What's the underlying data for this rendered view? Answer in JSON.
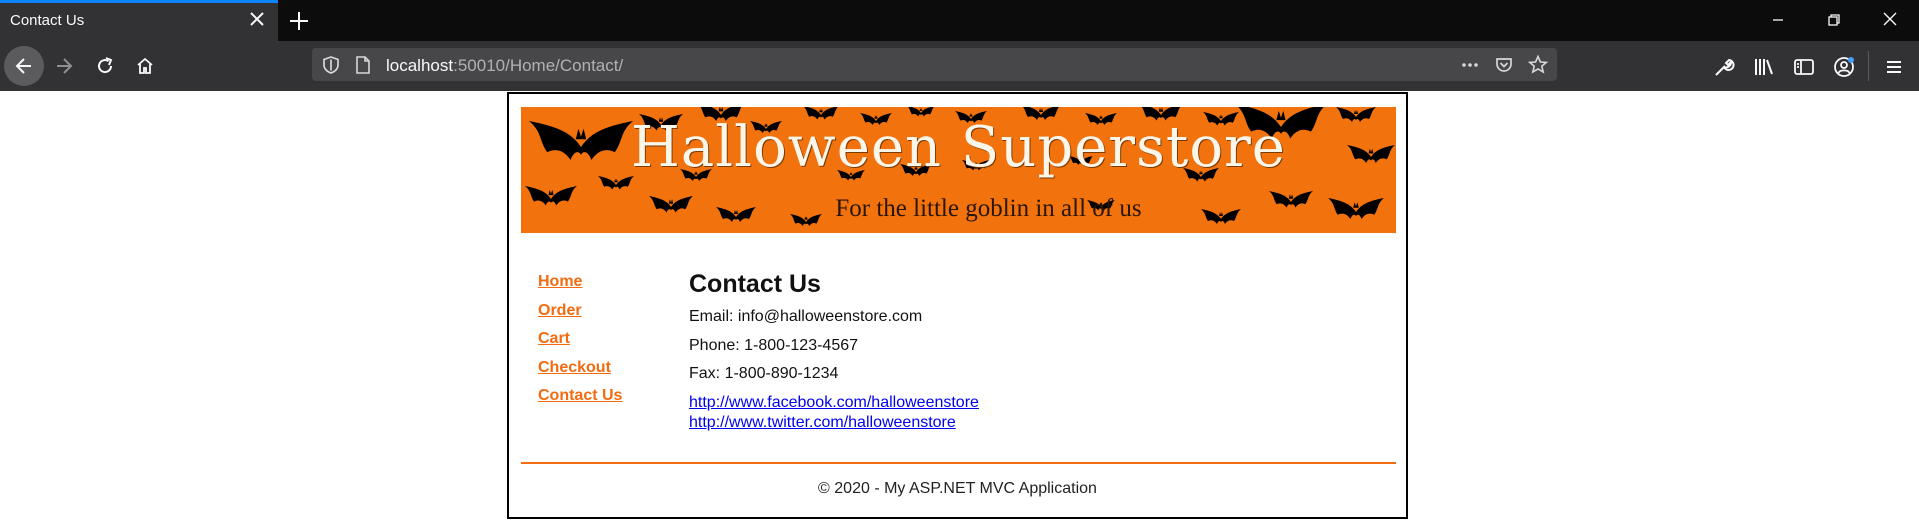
{
  "browser": {
    "tab_title": "Contact Us",
    "url_host": "localhost",
    "url_rest": ":50010/Home/Contact/",
    "accent_color": "#0a84ff",
    "icons": [
      "close-icon",
      "plus-icon",
      "minimize-icon",
      "restore-icon",
      "window-close-icon",
      "back-icon",
      "forward-icon",
      "reload-icon",
      "home-icon",
      "shield-icon",
      "page-icon",
      "more-icon",
      "pocket-icon",
      "star-icon",
      "wrench-icon",
      "library-icon",
      "sidebar-icon",
      "account-icon",
      "menu-icon"
    ]
  },
  "banner": {
    "title": "Halloween Superstore",
    "subtitle": "For the little goblin in all of us",
    "color": "#f2720d"
  },
  "nav": {
    "links": [
      "Home",
      "Order",
      "Cart",
      "Checkout",
      "Contact Us"
    ],
    "color": "#f26b10"
  },
  "contact": {
    "heading": "Contact Us",
    "email": "Email: info@halloweenstore.com",
    "phone": "Phone: 1-800-123-4567",
    "fax": "Fax: 1-800-890-1234",
    "facebook": "http://www.facebook.com/halloweenstore",
    "twitter": "http://www.twitter.com/halloweenstore"
  },
  "footer": {
    "text": "© 2020 - My ASP.NET MVC Application"
  }
}
